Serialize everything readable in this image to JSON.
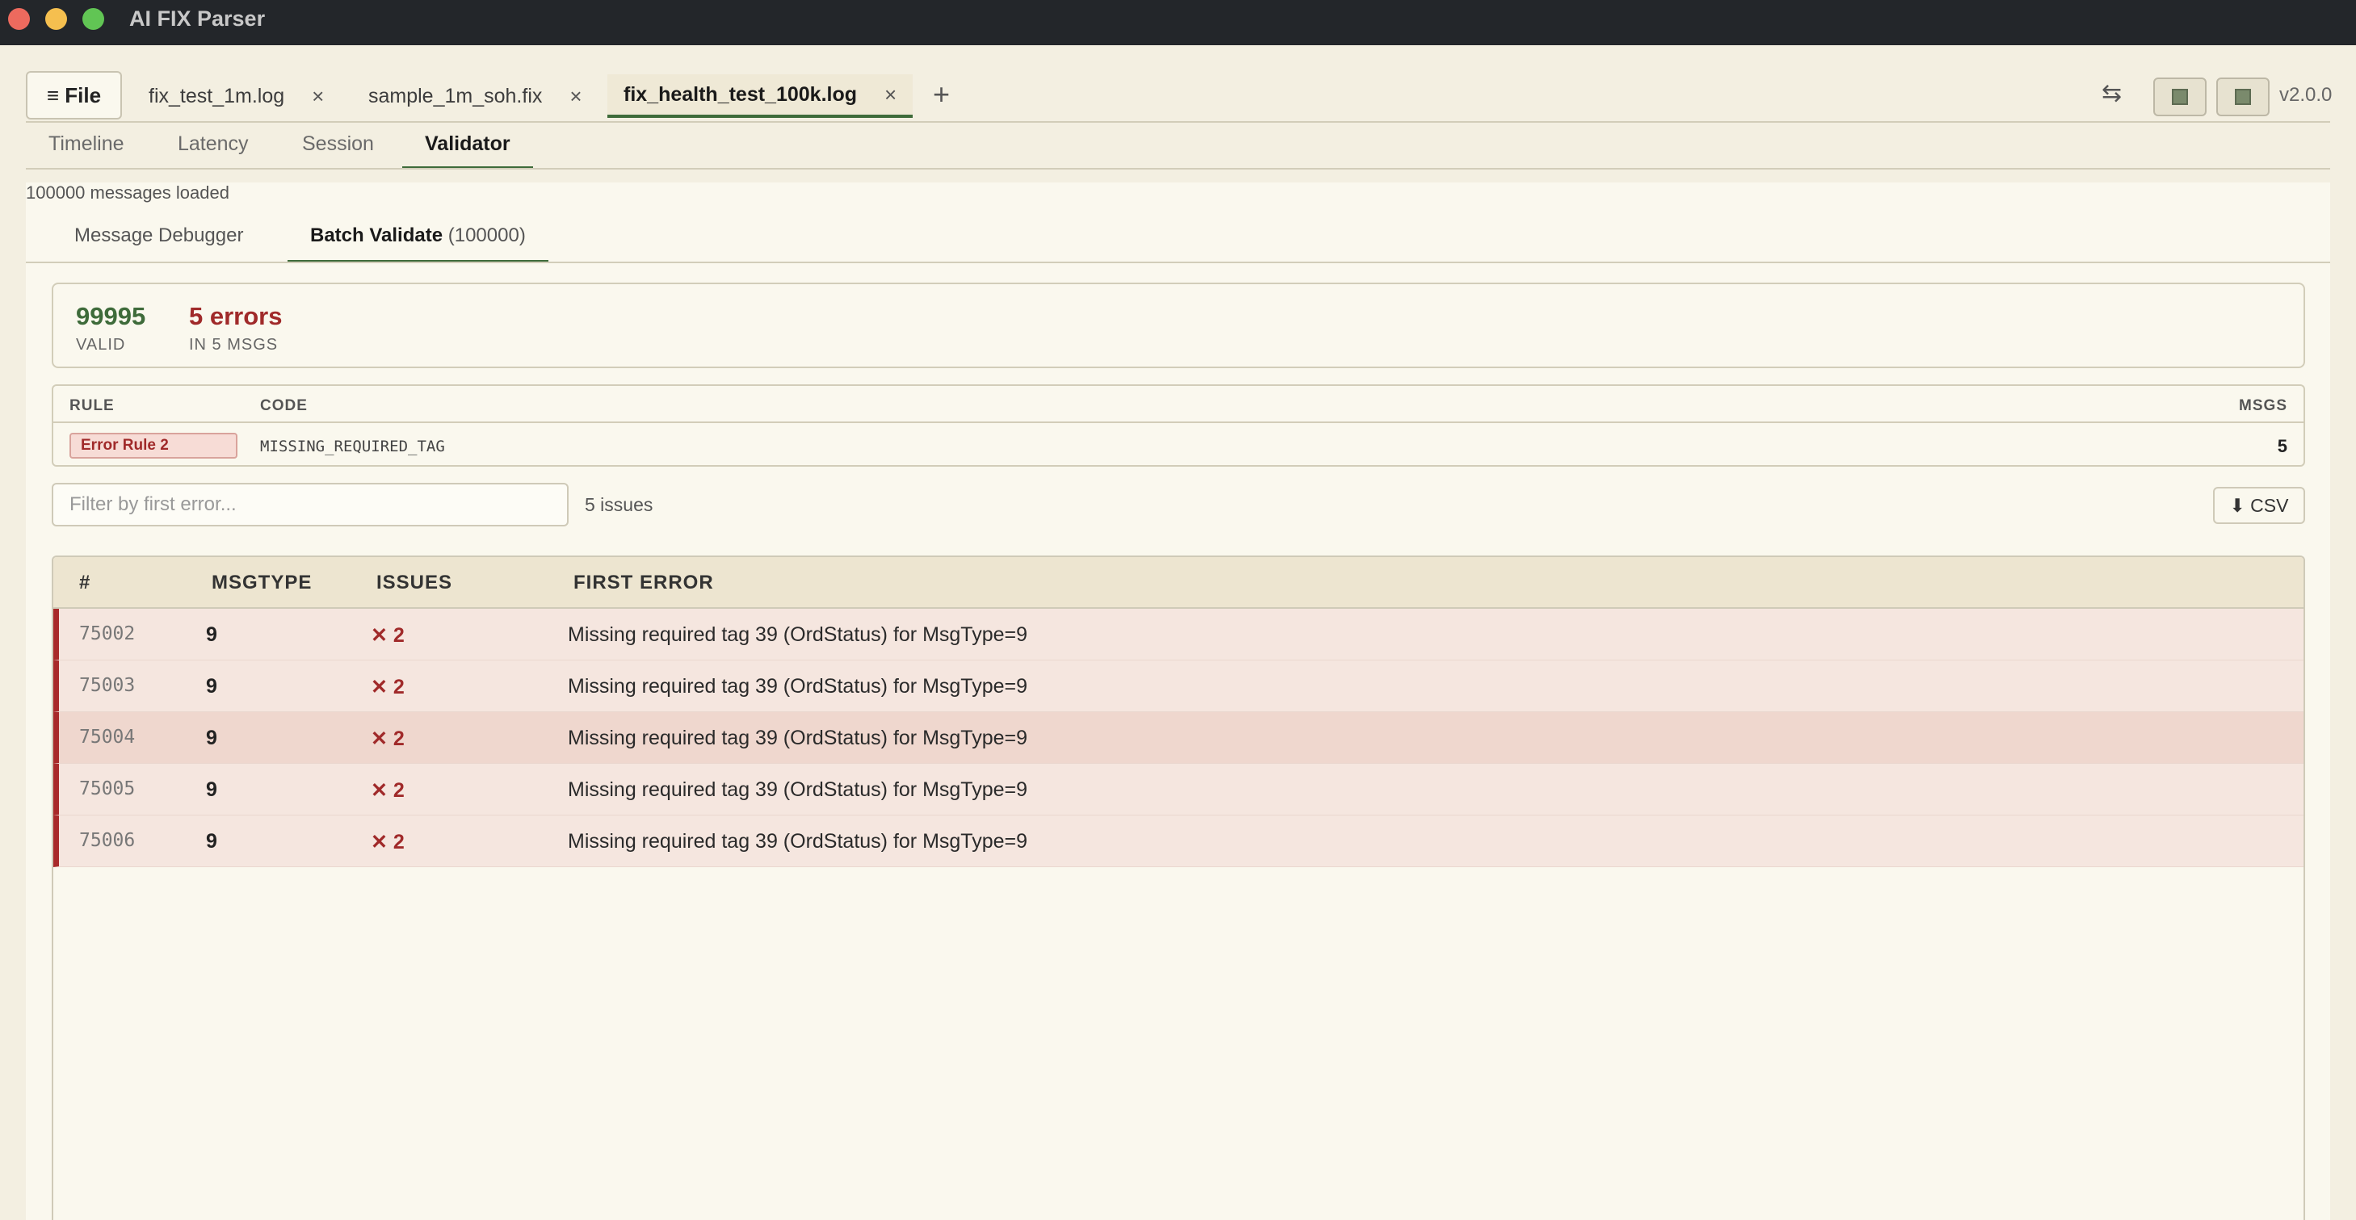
{
  "app": {
    "title": "AI FIX Parser",
    "version": "v2.0.0"
  },
  "toolbar": {
    "file_label": "≡ File",
    "tabs": [
      {
        "label": "fix_test_1m.log",
        "close": "×"
      },
      {
        "label": "sample_1m_soh.fix",
        "close": "×"
      },
      {
        "label": "fix_health_test_100k.log",
        "close": "×"
      }
    ],
    "add": "+",
    "swap": "⇆"
  },
  "views": [
    "Timeline",
    "Latency",
    "Session",
    "Validator"
  ],
  "status": "100000 messages loaded",
  "subtabs": {
    "debugger": "Message Debugger",
    "batch": "Batch Validate",
    "batch_count": "(100000)"
  },
  "summary": {
    "valid_count": "99995",
    "valid_label": "VALID",
    "errors": "5 errors",
    "errors_label": "IN 5 MSGS"
  },
  "rules": {
    "headers": [
      "RULE",
      "CODE",
      "MSGS"
    ],
    "row": {
      "rule": "Error Rule 2",
      "code": "MISSING_REQUIRED_TAG",
      "msgs": "5"
    }
  },
  "filter": {
    "placeholder": "Filter by first error...",
    "issues": "5 issues",
    "csv": "⬇ CSV"
  },
  "table": {
    "headers": [
      "#",
      "MSGTYPE",
      "ISSUES",
      "FIRST ERROR"
    ],
    "rows": [
      {
        "num": "75002",
        "type": "9",
        "issues": "✕ 2",
        "error": "Missing required tag 39 (OrdStatus) for MsgType=9"
      },
      {
        "num": "75003",
        "type": "9",
        "issues": "✕ 2",
        "error": "Missing required tag 39 (OrdStatus) for MsgType=9"
      },
      {
        "num": "75004",
        "type": "9",
        "issues": "✕ 2",
        "error": "Missing required tag 39 (OrdStatus) for MsgType=9"
      },
      {
        "num": "75005",
        "type": "9",
        "issues": "✕ 2",
        "error": "Missing required tag 39 (OrdStatus) for MsgType=9"
      },
      {
        "num": "75006",
        "type": "9",
        "issues": "✕ 2",
        "error": "Missing required tag 39 (OrdStatus) for MsgType=9"
      }
    ]
  },
  "colors": {
    "accent": "#3e6b3a",
    "error": "#a02a2a",
    "background": "#f3efe1"
  }
}
